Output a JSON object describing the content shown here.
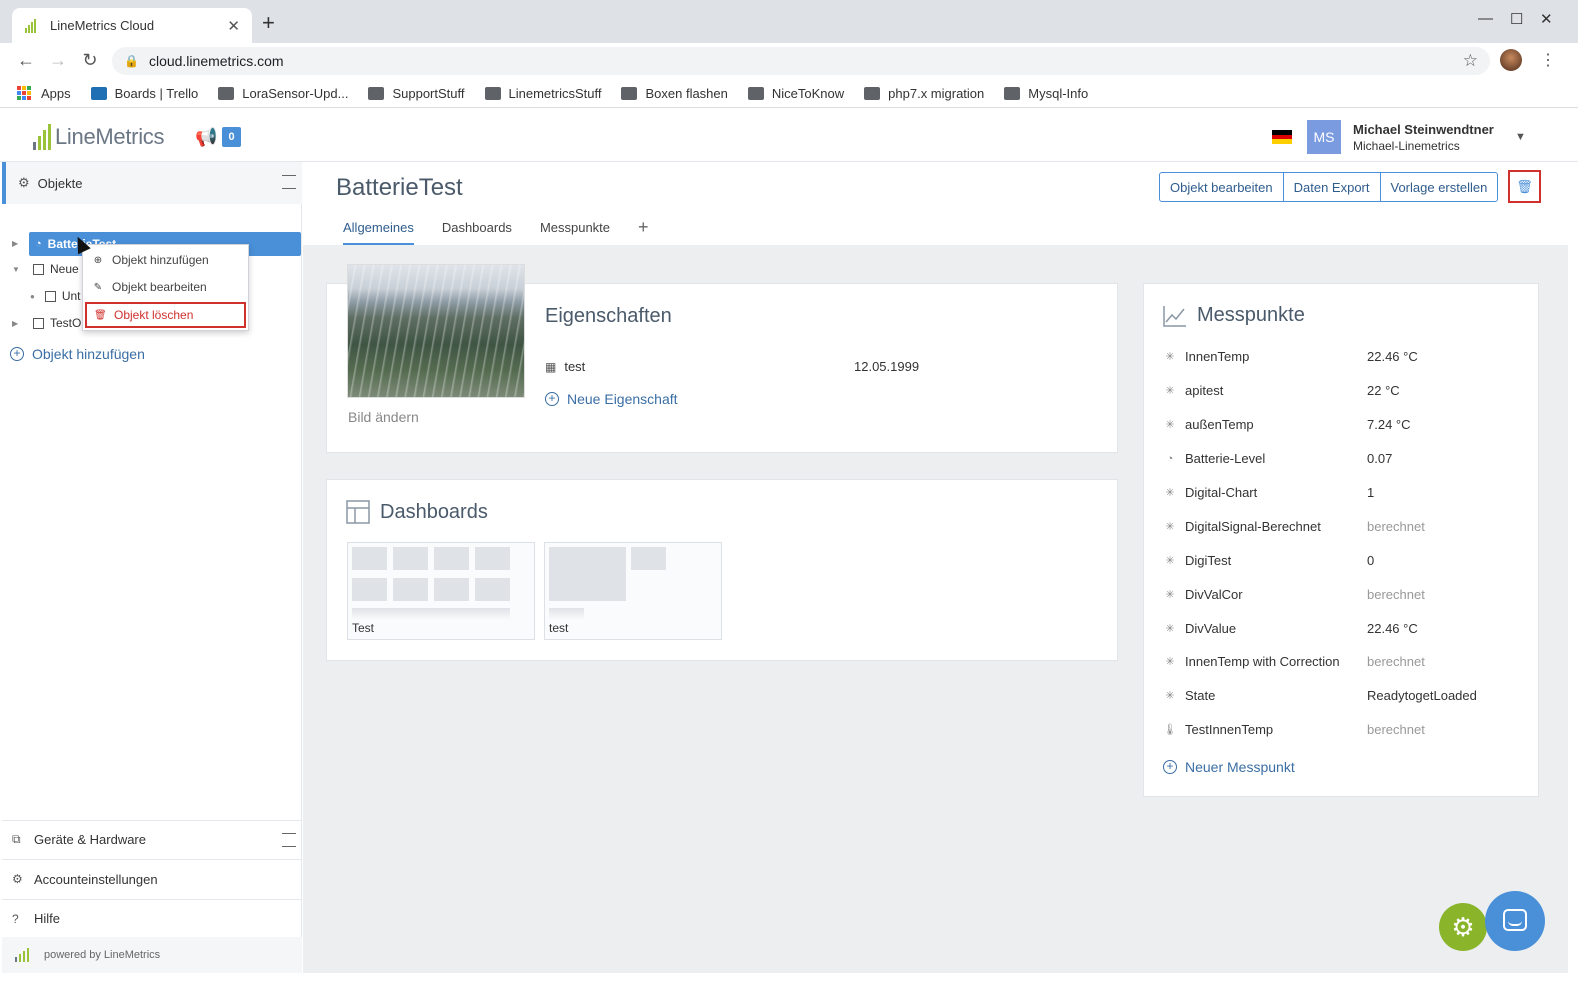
{
  "browser": {
    "tab_title": "LineMetrics Cloud",
    "url": "cloud.linemetrics.com",
    "bookmarks": [
      {
        "label": "Apps",
        "icon": "apps-grid-icon"
      },
      {
        "label": "Boards | Trello",
        "icon": "trello-icon"
      },
      {
        "label": "LoraSensor-Upd...",
        "icon": "folder-icon"
      },
      {
        "label": "SupportStuff",
        "icon": "folder-icon"
      },
      {
        "label": "LinemetricsStuff",
        "icon": "folder-icon"
      },
      {
        "label": "Boxen flashen",
        "icon": "folder-icon"
      },
      {
        "label": "NiceToKnow",
        "icon": "folder-icon"
      },
      {
        "label": "php7.x migration",
        "icon": "folder-icon"
      },
      {
        "label": "Mysql-Info",
        "icon": "folder-icon"
      }
    ]
  },
  "header": {
    "logo_text": "LineMetrics",
    "notification_count": "0",
    "avatar_initials": "MS",
    "user_name": "Michael Steinwendtner",
    "account_name": "Michael-Linemetrics"
  },
  "sidebar": {
    "section_title": "Objekte",
    "tree": [
      {
        "label": "BatterieTest",
        "selected": true
      },
      {
        "label": "Neue"
      },
      {
        "label": "Unt"
      },
      {
        "label": "TestO"
      }
    ],
    "add_object": "Objekt hinzufügen",
    "bottom": [
      {
        "label": "Geräte & Hardware",
        "icon": "devices-icon"
      },
      {
        "label": "Accounteinstellungen",
        "icon": "gear-icon"
      },
      {
        "label": "Hilfe",
        "icon": "help-icon"
      }
    ],
    "powered_by": "powered by LineMetrics"
  },
  "context_menu": {
    "items": [
      {
        "label": "Objekt hinzufügen",
        "icon": "plus-circle-icon"
      },
      {
        "label": "Objekt bearbeiten",
        "icon": "pencil-icon"
      },
      {
        "label": "Objekt löschen",
        "icon": "trash-icon"
      }
    ]
  },
  "main": {
    "title": "BatterieTest",
    "actions": [
      "Objekt bearbeiten",
      "Daten Export",
      "Vorlage erstellen"
    ],
    "tabs": [
      "Allgemeines",
      "Dashboards",
      "Messpunkte",
      "+"
    ],
    "image_change": "Bild ändern",
    "properties": {
      "title": "Eigenschaften",
      "rows": [
        {
          "name": "test",
          "value": "12.05.1999"
        }
      ],
      "add": "Neue Eigenschaft"
    },
    "dashboards": {
      "title": "Dashboards",
      "items": [
        "Test",
        "test"
      ]
    },
    "messpunkte": {
      "title": "Messpunkte",
      "rows": [
        {
          "name": "InnenTemp",
          "value": "22.46 °C",
          "icon": "spinner-icon"
        },
        {
          "name": "apitest",
          "value": "22 °C",
          "icon": "spinner-icon"
        },
        {
          "name": "außenTemp",
          "value": "7.24 °C",
          "icon": "spinner-icon"
        },
        {
          "name": "Batterie-Level",
          "value": "0.07",
          "icon": "gauge-icon"
        },
        {
          "name": "Digital-Chart",
          "value": "1",
          "icon": "spinner-icon"
        },
        {
          "name": "DigitalSignal-Berechnet",
          "value": "berechnet",
          "icon": "spinner-icon"
        },
        {
          "name": "DigiTest",
          "value": "0",
          "icon": "spinner-icon"
        },
        {
          "name": "DivValCor",
          "value": "berechnet",
          "icon": "spinner-icon"
        },
        {
          "name": "DivValue",
          "value": "22.46 °C",
          "icon": "spinner-icon"
        },
        {
          "name": "InnenTemp with Correction",
          "value": "berechnet",
          "icon": "spinner-icon"
        },
        {
          "name": "State",
          "value": "ReadytogetLoaded",
          "icon": "spinner-icon"
        },
        {
          "name": "TestInnenTemp",
          "value": "berechnet",
          "icon": "thermometer-icon"
        }
      ],
      "add": "Neuer Messpunkt"
    }
  },
  "colors": {
    "accent": "#4a90d9",
    "danger": "#d0312d",
    "brand_green": "#9bc33a"
  }
}
